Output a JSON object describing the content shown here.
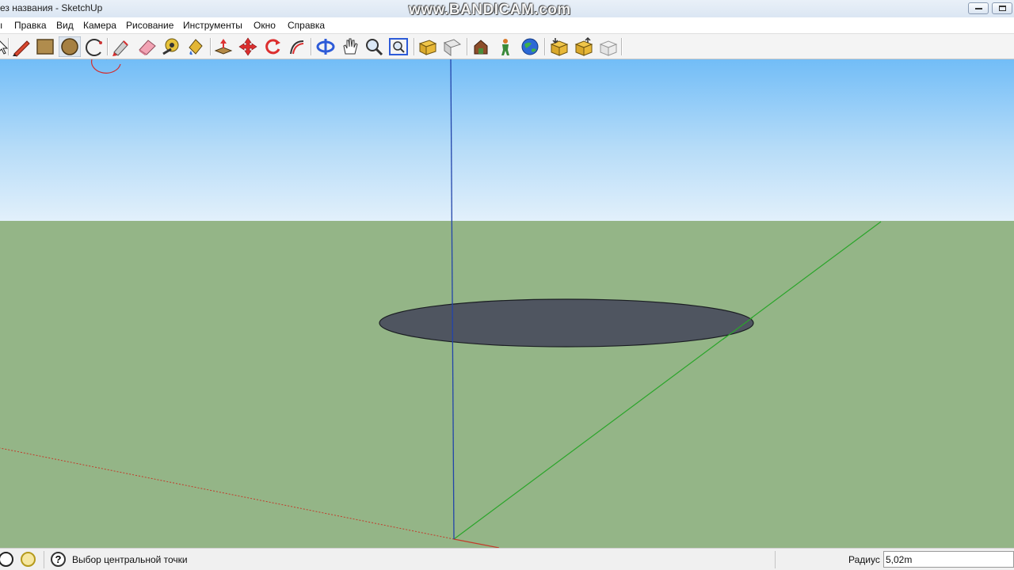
{
  "window": {
    "title": "ез названия - SketchUp",
    "watermark": "www.BANDICAM.com"
  },
  "menu": [
    "Правка",
    "Вид",
    "Камера",
    "Рисование",
    "Инструменты",
    "Окно",
    "Справка"
  ],
  "toolbar": {
    "tools": [
      "select-icon",
      "pencil-icon",
      "rectangle-icon",
      "circle-icon",
      "arc-icon",
      "paint-bucket-icon",
      "eraser-icon",
      "tape-measure-icon",
      "paint-icon",
      "push-pull-icon",
      "move-icon",
      "rotate-icon",
      "follow-me-icon",
      "orbit-icon",
      "pan-icon",
      "zoom-icon",
      "zoom-extents-icon",
      "section-icon",
      "section-plane-icon",
      "house-icon",
      "person-icon",
      "globe-icon",
      "get-models-icon",
      "share-model-icon",
      "extension-icon"
    ]
  },
  "scene": {
    "sky_color": "#72bdf7",
    "ground_color": "#94b587",
    "circle_face_color": "#4f5560",
    "axes": {
      "red": "#c23b2b",
      "green": "#2aa52a",
      "blue": "#2244aa"
    }
  },
  "status": {
    "hint": "Выбор центральной точки",
    "measure_label": "Радиус",
    "measure_value": "5,02m"
  }
}
